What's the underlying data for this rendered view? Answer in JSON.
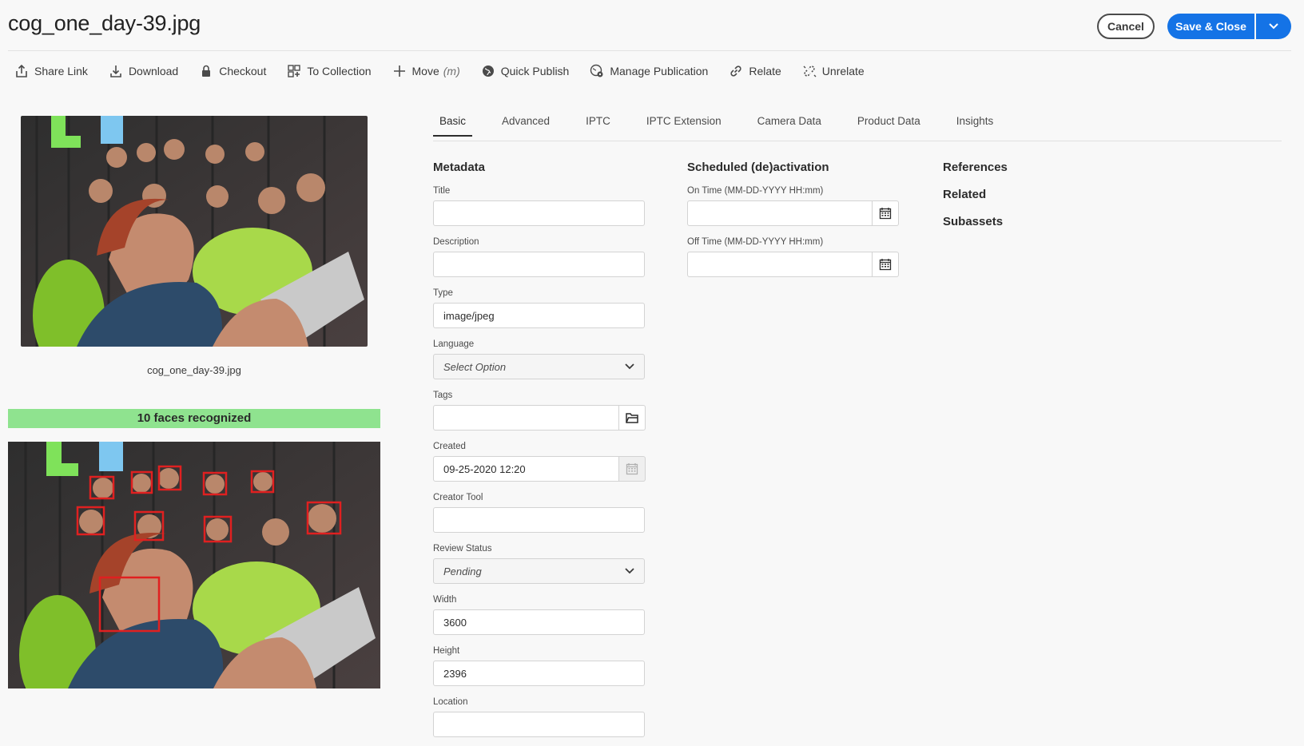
{
  "header": {
    "title": "cog_one_day-39.jpg",
    "cancel_label": "Cancel",
    "save_label": "Save & Close"
  },
  "toolbar": {
    "items": [
      {
        "label": "Share Link",
        "icon": "share-icon"
      },
      {
        "label": "Download",
        "icon": "download-icon"
      },
      {
        "label": "Checkout",
        "icon": "lock-icon"
      },
      {
        "label": "To Collection",
        "icon": "collection-add-icon"
      },
      {
        "label": "Move",
        "shortcut": "(m)",
        "icon": "plus-move-icon"
      },
      {
        "label": "Quick Publish",
        "icon": "globe-icon"
      },
      {
        "label": "Manage Publication",
        "icon": "globe-gear-icon"
      },
      {
        "label": "Relate",
        "icon": "link-icon"
      },
      {
        "label": "Unrelate",
        "icon": "unlink-icon"
      }
    ]
  },
  "preview": {
    "caption": "cog_one_day-39.jpg",
    "faces_text": "10 faces recognized"
  },
  "tabs": [
    {
      "label": "Basic",
      "active": true
    },
    {
      "label": "Advanced"
    },
    {
      "label": "IPTC"
    },
    {
      "label": "IPTC Extension"
    },
    {
      "label": "Camera Data"
    },
    {
      "label": "Product Data"
    },
    {
      "label": "Insights"
    }
  ],
  "metadata": {
    "heading": "Metadata",
    "title_label": "Title",
    "title_value": "",
    "description_label": "Description",
    "description_value": "",
    "type_label": "Type",
    "type_value": "image/jpeg",
    "language_label": "Language",
    "language_value": "Select Option",
    "tags_label": "Tags",
    "tags_value": "",
    "created_label": "Created",
    "created_value": "09-25-2020 12:20",
    "creator_tool_label": "Creator Tool",
    "creator_tool_value": "",
    "review_status_label": "Review Status",
    "review_status_value": "Pending",
    "width_label": "Width",
    "width_value": "3600",
    "height_label": "Height",
    "height_value": "2396",
    "location_label": "Location",
    "location_value": ""
  },
  "scheduled": {
    "heading": "Scheduled (de)activation",
    "on_time_label": "On Time (MM-DD-YYYY HH:mm)",
    "off_time_label": "Off Time (MM-DD-YYYY HH:mm)"
  },
  "right_links": [
    "References",
    "Related",
    "Subassets"
  ],
  "colors": {
    "accent": "#1473e6",
    "faces_bar": "#8fe38f",
    "face_box": "#e02020"
  }
}
